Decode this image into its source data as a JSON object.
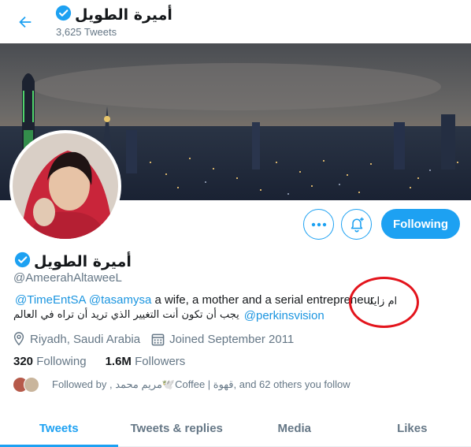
{
  "header": {
    "name": "أميرة الطويل",
    "tweet_count": "3,625 Tweets"
  },
  "profile": {
    "name": "أميرة الطويل",
    "handle": "@AmeerahAltaweeL",
    "verified": true
  },
  "actions": {
    "following_label": "Following"
  },
  "bio": {
    "mention_1": "@TimeEntSA",
    "mention_2": "@tasamysa",
    "text_1": "a wife, a mother and a serial entrepreneur",
    "arabic_note": "ام زايد",
    "arabic_quote": "يجب أن تكون أنت التغيير الذي تريد أن تراه في العالم",
    "mention_3": "@perkinsvision"
  },
  "meta": {
    "location": "Riyadh, Saudi Arabia",
    "joined": "Joined September 2011"
  },
  "stats": {
    "following_count": "320",
    "following_label": "Following",
    "followers_count": "1.6M",
    "followers_label": "Followers"
  },
  "followed_by": {
    "text": "Followed by  , مريم محمد🕊️Coffee | قهوة, and 62 others you follow"
  },
  "tabs": [
    {
      "label": "Tweets",
      "active": true
    },
    {
      "label": "Tweets & replies",
      "active": false
    },
    {
      "label": "Media",
      "active": false
    },
    {
      "label": "Likes",
      "active": false
    }
  ],
  "colors": {
    "accent": "#1da1f2",
    "mention": "#1b95e0",
    "muted": "#657786",
    "annotation_red": "#e3141c"
  }
}
